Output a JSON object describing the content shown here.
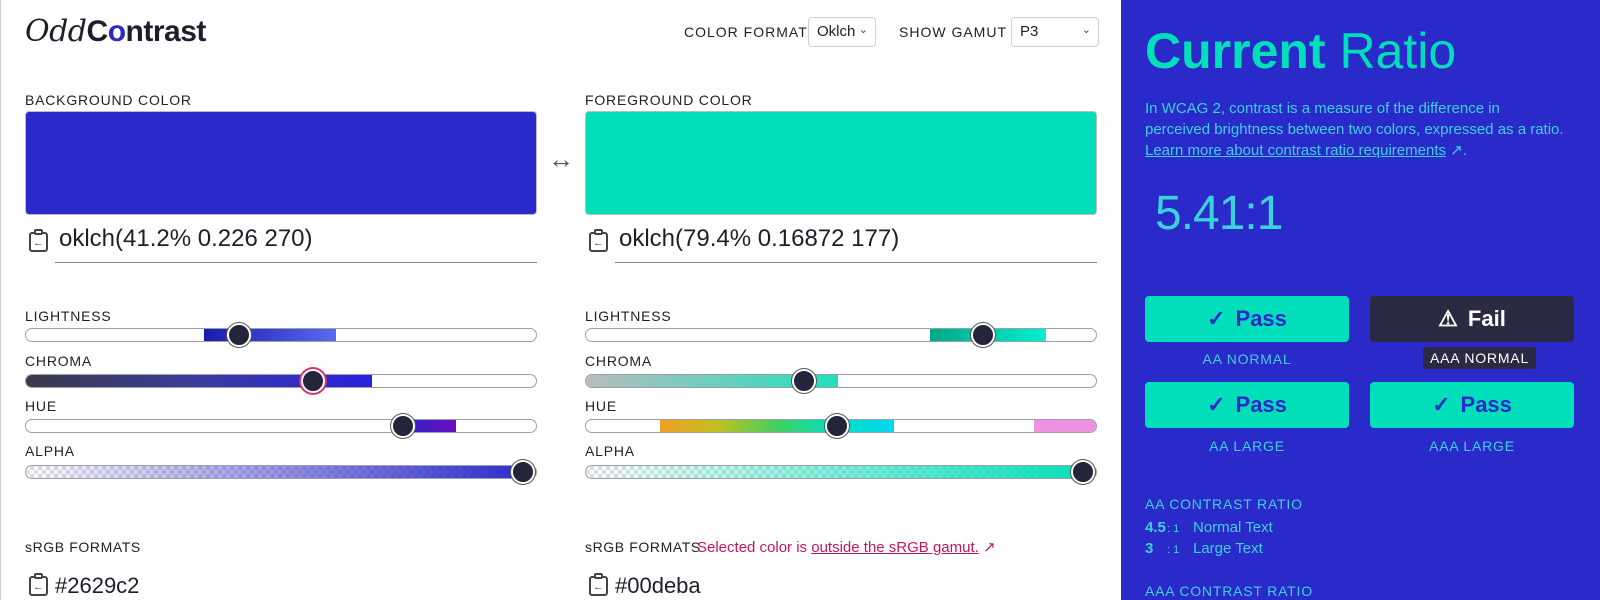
{
  "header": {
    "logo_odd": "Odd",
    "logo_contrast": "Contrast",
    "color_format_label": "COLOR FORMAT",
    "color_format_value": "Oklch",
    "show_gamut_label": "SHOW GAMUT",
    "show_gamut_value": "P3"
  },
  "background": {
    "label": "BACKGROUND COLOR",
    "swatch": "#2a29c9",
    "value": "oklch(41.2% 0.226 270)",
    "sliders": {
      "lightness": "LIGHTNESS",
      "chroma": "CHROMA",
      "hue": "HUE",
      "alpha": "ALPHA"
    },
    "formats_label": "sRGB FORMATS",
    "hex": "#2629c2"
  },
  "foreground": {
    "label": "FOREGROUND COLOR",
    "swatch": "#00dfba",
    "value": "oklch(79.4% 0.16872 177)",
    "sliders": {
      "lightness": "LIGHTNESS",
      "chroma": "CHROMA",
      "hue": "HUE",
      "alpha": "ALPHA"
    },
    "formats_label": "sRGB FORMATS",
    "warning_prefix": "Selected color is ",
    "warning_link": "outside the sRGB gamut.",
    "hex": "#00deba"
  },
  "panel": {
    "title_bold": "Current",
    "title_rest": "Ratio",
    "intro_text": "In WCAG 2, contrast is a measure of the difference in perceived brightness between two colors, expressed as a ratio. ",
    "intro_link": "Learn more about contrast ratio requirements",
    "intro_end": ".",
    "ratio": "5.41:1",
    "results": [
      {
        "status": "Pass",
        "label": "AA NORMAL"
      },
      {
        "status": "Fail",
        "label": "AAA NORMAL"
      },
      {
        "status": "Pass",
        "label": "AA LARGE"
      },
      {
        "status": "Pass",
        "label": "AAA LARGE"
      }
    ],
    "aa_head": "AA CONTRAST RATIO",
    "aa_rows": [
      {
        "value": "4.5",
        "unit": ": 1",
        "text": "Normal Text"
      },
      {
        "value": "3",
        "unit": ": 1",
        "text": "Large Text"
      }
    ],
    "aaa_head": "AAA CONTRAST RATIO"
  },
  "colors": {
    "accent": "#2a29c9",
    "foreground": "#00dfba",
    "fail": "#2a2b42",
    "warning": "#c2185b"
  }
}
